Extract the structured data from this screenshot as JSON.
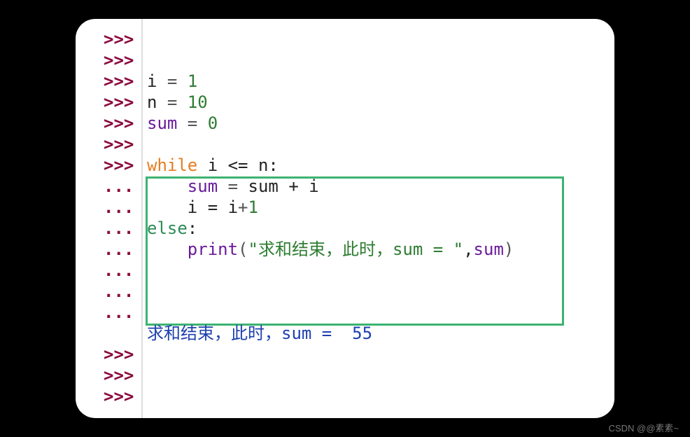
{
  "prompts": {
    "p": ">>>",
    "c": "..."
  },
  "lines": {
    "l1_i": "i",
    "l1_eq": " = ",
    "l1_v": "1",
    "l2_n": "n",
    "l2_eq": " = ",
    "l2_v": "10",
    "l3_sum": "sum",
    "l3_eq": " = ",
    "l3_v": "0",
    "l4_while": "while",
    "l4_rest": " i <= n",
    "l4_colon": ":",
    "l5_indent": "    ",
    "l5_sum": "sum",
    "l5_eq": " = ",
    "l5_rhs": "sum + i",
    "l6_indent": "    ",
    "l6_lhs": "i = i",
    "l6_plus": "+",
    "l6_one": "1",
    "l7_else": "else",
    "l7_colon": ":",
    "l8_indent": "    ",
    "l8_print": "print",
    "l8_open": "(",
    "l8_str": "\"求和结束，此时，sum = \"",
    "l8_comma": ",",
    "l8_arg": "sum",
    "l8_close": ")",
    "out_text": "求和结束，此时，sum =  55"
  },
  "watermark": "CSDN @@素素~"
}
